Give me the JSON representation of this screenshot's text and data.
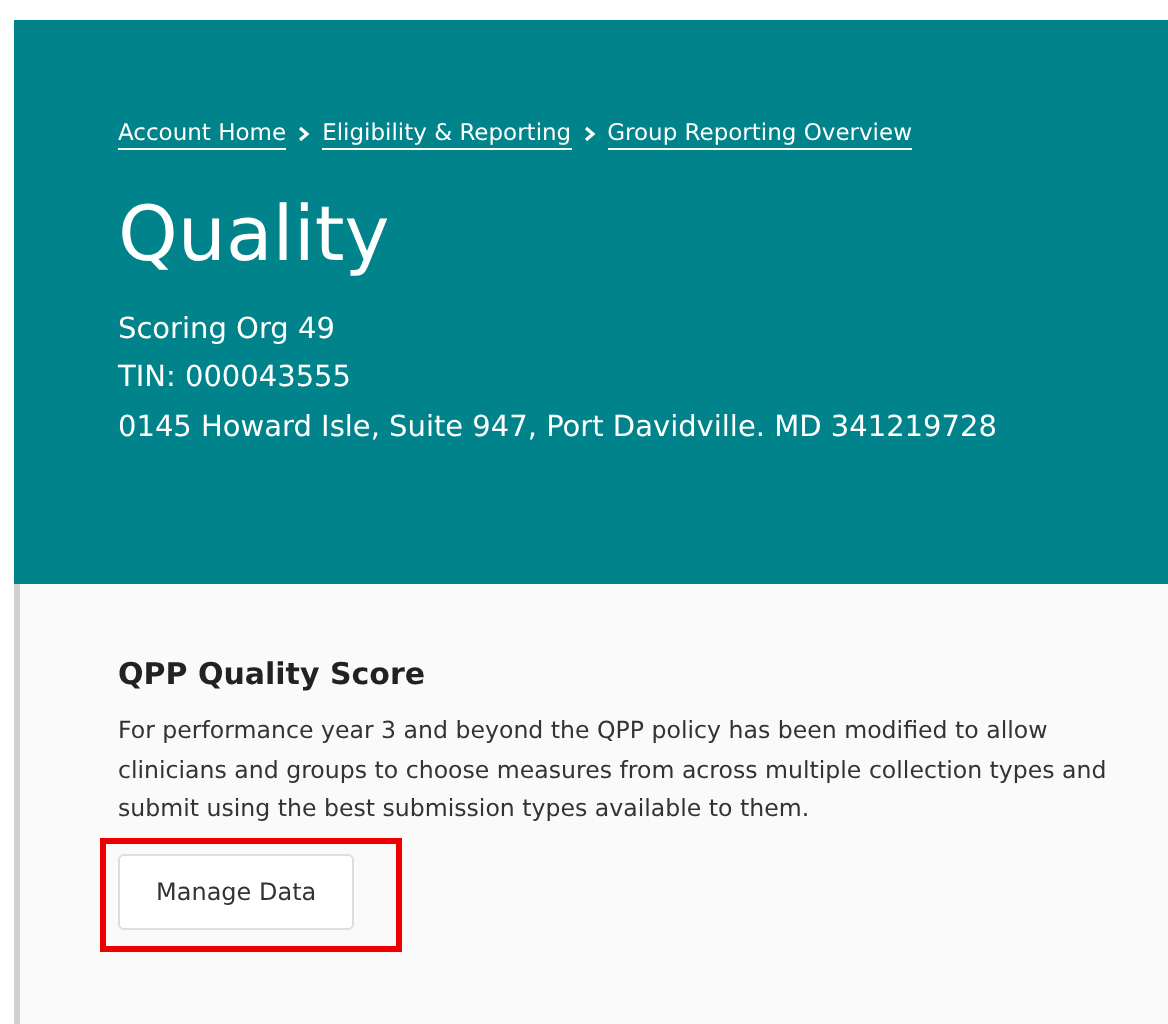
{
  "breadcrumbs": [
    {
      "label": "Account Home"
    },
    {
      "label": "Eligibility & Reporting"
    },
    {
      "label": "Group Reporting Overview"
    }
  ],
  "title": "Quality",
  "details": [
    "Scoring Org 49",
    "TIN: 000043555",
    "0145 Howard Isle, Suite 947, Port Davidville. MD 341219728"
  ],
  "section": {
    "heading": "QPP Quality Score",
    "text": "For performance year 3 and beyond the QPP policy has been modified to allow clinicians and groups to choose measures from across multiple collection types and submit using the best submission types available to them.",
    "button": {
      "label": "Manage Data",
      "highlighted": true
    }
  }
}
